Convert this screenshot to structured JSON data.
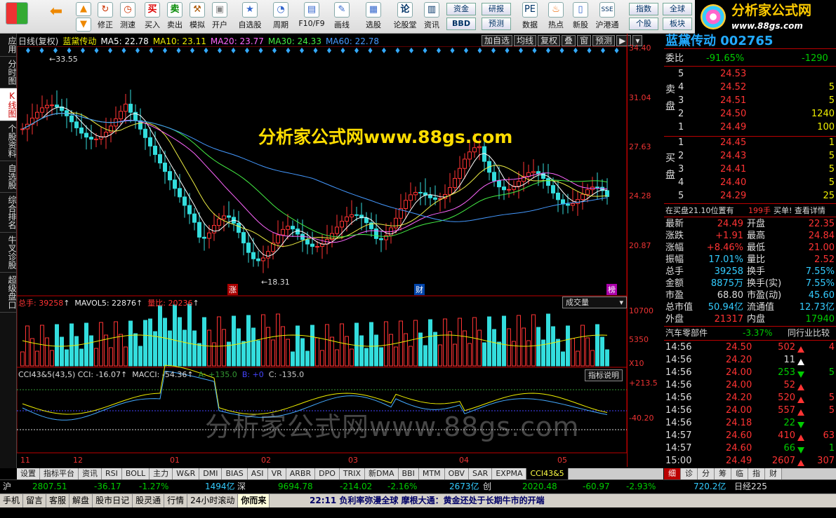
{
  "toolbar": {
    "buttons": [
      "修正",
      "测速",
      "买入",
      "卖出",
      "模拟",
      "开户",
      "自选股",
      "周期",
      "F10/F9",
      "画线",
      "选股",
      "论股堂",
      "资讯",
      "数据",
      "热点",
      "新股",
      "沪港通"
    ],
    "small_buttons": [
      "资金",
      "研报",
      "BBD",
      "预测",
      "指数",
      "全球",
      "个股",
      "板块"
    ],
    "logo_text": "分析家公式网",
    "logo_url": "www.88gs.com"
  },
  "left_tabs": [
    "应用",
    "分时图",
    "K线图",
    "个股资料",
    "自选股",
    "综合排名",
    "牛叉诊股",
    "超级盘口"
  ],
  "chart": {
    "period": "日线(复权)",
    "stock_name": "蓝黛传动",
    "ma5": "MA5: 22.78",
    "ma10": "MA10: 23.11",
    "ma20": "MA20: 23.77",
    "ma30": "MA30: 24.33",
    "ma60": "MA60: 22.78",
    "tools": [
      "加自选",
      "均线",
      "复权",
      "叠",
      "窗",
      "预测"
    ],
    "price_axis": [
      "34.40",
      "31.04",
      "27.63",
      "24.28",
      "20.87"
    ],
    "high_label": "33.55",
    "low_label": "18.31",
    "event_labels": [
      "涨",
      "财",
      "榜"
    ],
    "colors": {
      "up": "#ff3333",
      "down": "#33dddd",
      "ma5": "#ffffff",
      "ma10": "#eeee44",
      "ma20": "#ff66ff",
      "ma30": "#44ee44",
      "ma60": "#4499ff"
    }
  },
  "volume": {
    "header": "总手: 39258",
    "mavol": "MAVOL5: 22876",
    "ratio": "量比: 20236",
    "selector": "成交量",
    "axis": [
      "10700",
      "5350",
      "X10"
    ]
  },
  "cci": {
    "header": "CCI43&5(43,5) CCI: -16.07",
    "macci": "MACCI: -54.36",
    "a": "A: +135.0",
    "b": "B: +0",
    "c": "C: -135.0",
    "selector": "指标说明",
    "axis": [
      "+213.5",
      "-40.20"
    ]
  },
  "x_axis": [
    "11",
    "12",
    "01",
    "02",
    "03",
    "04",
    "05"
  ],
  "bottom_tabs": [
    "设置",
    "指标平台",
    "资讯",
    "RSI",
    "BOLL",
    "主力",
    "W&R",
    "DMI",
    "BIAS",
    "ASI",
    "VR",
    "ARBR",
    "DPO",
    "TRIX",
    "新DMA",
    "BBI",
    "MTM",
    "OBV",
    "SAR",
    "EXPMA",
    "CCI43&5"
  ],
  "status": {
    "sh_label": "沪",
    "sh_index": "2807.51",
    "sh_chg": "-36.17",
    "sh_pct": "-1.27%",
    "sh_amt": "1494亿",
    "sz_label": "深",
    "sz_index": "9694.78",
    "sz_chg": "-214.02",
    "sz_pct": "-2.16%",
    "sz_amt": "2673亿",
    "cy_label": "创",
    "cy_index": "2020.48",
    "cy_chg": "-60.97",
    "cy_pct": "-2.93%",
    "cy_amt": "720.2亿",
    "extra": "日经225"
  },
  "status2": {
    "items": [
      "手机",
      "留言",
      "客服",
      "解盘",
      "股市日记",
      "股灵通",
      "行情",
      "24小时滚动"
    ],
    "flash": "你而来",
    "ticker_time": "22:11",
    "ticker_text": "负利率弥漫全球 摩根大通：黄金还处于长期牛市的开端"
  },
  "right_panel": {
    "title": "蓝黛传动 002765",
    "weibi_label": "委比",
    "weibi": "-91.65%",
    "weicha": "-1290",
    "sell_label": "卖盘",
    "buy_label": "买盘",
    "sells": [
      {
        "lvl": "5",
        "price": "24.53",
        "vol": ""
      },
      {
        "lvl": "4",
        "price": "24.52",
        "vol": "5"
      },
      {
        "lvl": "3",
        "price": "24.51",
        "vol": "5"
      },
      {
        "lvl": "2",
        "price": "24.50",
        "vol": "1240"
      },
      {
        "lvl": "1",
        "price": "24.49",
        "vol": "100"
      }
    ],
    "buys": [
      {
        "lvl": "1",
        "price": "24.45",
        "vol": "1"
      },
      {
        "lvl": "2",
        "price": "24.43",
        "vol": "5"
      },
      {
        "lvl": "3",
        "price": "24.41",
        "vol": "5"
      },
      {
        "lvl": "4",
        "price": "24.40",
        "vol": "5"
      },
      {
        "lvl": "5",
        "price": "24.29",
        "vol": "25"
      }
    ],
    "buy_pos": "在买盘21.10位置有",
    "buy_pos_vol": "199手",
    "buy_pos_link": "买单! 查看详情",
    "stats": [
      {
        "l1": "最新",
        "v1": "24.49",
        "l2": "开盘",
        "v2": "22.35"
      },
      {
        "l1": "涨跌",
        "v1": "+1.91",
        "l2": "最高",
        "v2": "24.84"
      },
      {
        "l1": "涨幅",
        "v1": "+8.46%",
        "l2": "最低",
        "v2": "21.00"
      },
      {
        "l1": "振幅",
        "v1": "17.01%",
        "l2": "量比",
        "v2": "2.52"
      },
      {
        "l1": "总手",
        "v1": "39258",
        "l2": "换手",
        "v2": "7.55%"
      },
      {
        "l1": "金额",
        "v1": "8875万",
        "l2": "换手(实)",
        "v2": "7.55%"
      },
      {
        "l1": "市盈",
        "v1": "68.80",
        "l2": "市盈(动)",
        "v2": "45.60"
      },
      {
        "l1": "总市值",
        "v1": "50.94亿",
        "l2": "流通值",
        "v2": "12.73亿"
      },
      {
        "l1": "外盘",
        "v1": "21317",
        "l2": "内盘",
        "v2": "17940"
      }
    ],
    "industry": "汽车零部件",
    "industry_pct": "-3.37%",
    "industry_link": "同行业比较",
    "ticks": [
      {
        "t": "14:56",
        "p": "24.50",
        "v": "502",
        "dir": "up",
        "x": "4"
      },
      {
        "t": "14:56",
        "p": "24.20",
        "v": "11",
        "dir": "flat",
        "x": ""
      },
      {
        "t": "14:56",
        "p": "24.00",
        "v": "253",
        "dir": "down",
        "x": "5"
      },
      {
        "t": "14:56",
        "p": "24.00",
        "v": "52",
        "dir": "up",
        "x": ""
      },
      {
        "t": "14:56",
        "p": "24.20",
        "v": "520",
        "dir": "up",
        "x": "5"
      },
      {
        "t": "14:56",
        "p": "24.00",
        "v": "557",
        "dir": "up",
        "x": "5"
      },
      {
        "t": "14:56",
        "p": "24.18",
        "v": "22",
        "dir": "down",
        "x": ""
      },
      {
        "t": "14:57",
        "p": "24.60",
        "v": "410",
        "dir": "up",
        "x": "63"
      },
      {
        "t": "14:57",
        "p": "24.60",
        "v": "66",
        "dir": "down",
        "x": "1"
      },
      {
        "t": "15:00",
        "p": "24.49",
        "v": "2607",
        "dir": "up",
        "x": "307"
      }
    ],
    "tabs": [
      "细",
      "诊",
      "分",
      "筹",
      "临",
      "指",
      "财"
    ]
  },
  "watermark_top": "分析家公式网www.88gs.com",
  "watermark_bottom": "分析家公式网www.88gs.com"
}
